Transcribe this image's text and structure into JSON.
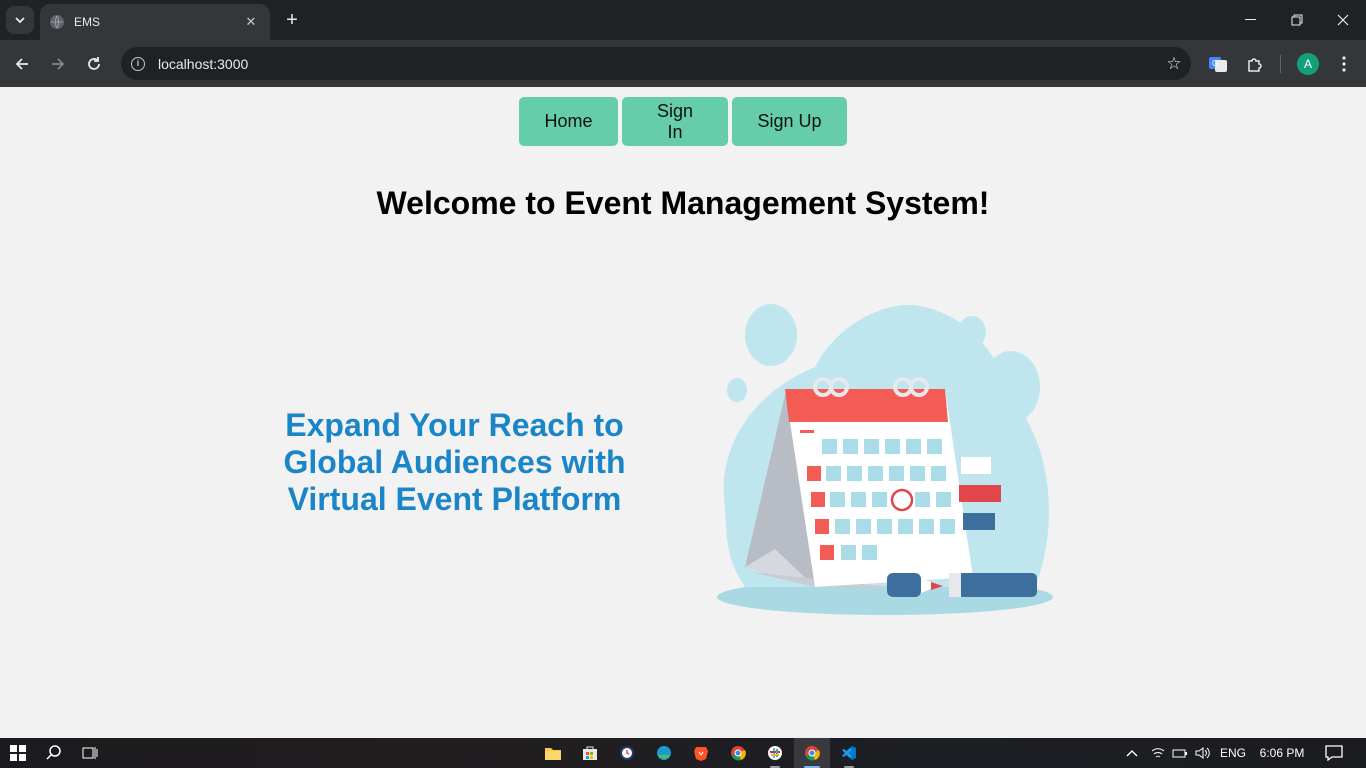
{
  "browser": {
    "tab_title": "EMS",
    "url": "localhost:3000",
    "profile_initial": "A"
  },
  "nav": {
    "home": "Home",
    "sign_in": "Sign In",
    "sign_up": "Sign Up"
  },
  "page": {
    "heading": "Welcome to Event Management System!",
    "tagline_line1": "Expand Your Reach to",
    "tagline_line2": "Global Audiences with",
    "tagline_line3": "Virtual Event Platform",
    "nav_color": "#66cdaa",
    "tagline_color": "#1a86c8"
  },
  "taskbar": {
    "language": "ENG",
    "time": "6:06 PM",
    "apps": [
      "file-explorer",
      "store",
      "clock-app",
      "edge",
      "brave",
      "chrome",
      "slack",
      "chrome-active",
      "vscode"
    ]
  }
}
